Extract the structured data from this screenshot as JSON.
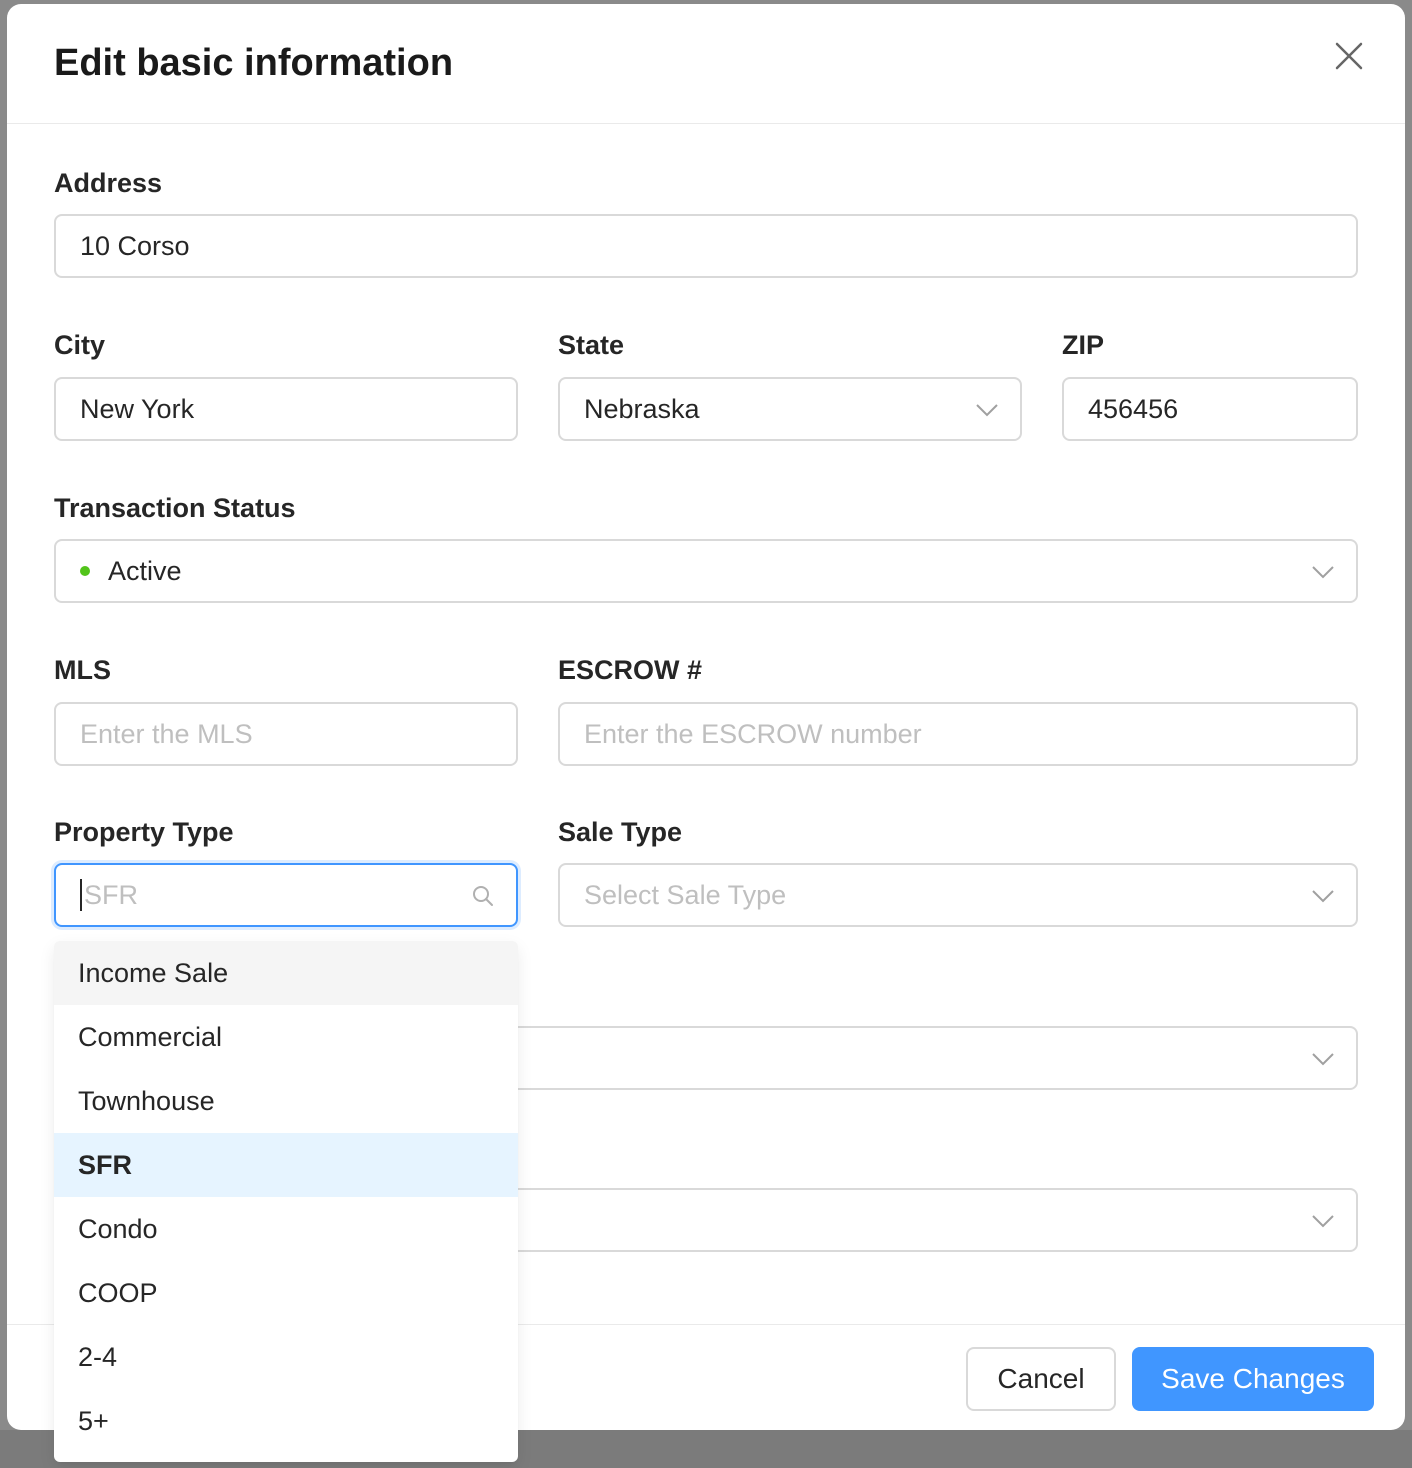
{
  "modal": {
    "title": "Edit basic information"
  },
  "address": {
    "label": "Address",
    "value": "10 Corso"
  },
  "city": {
    "label": "City",
    "value": "New York"
  },
  "state": {
    "label": "State",
    "value": "Nebraska"
  },
  "zip": {
    "label": "ZIP",
    "value": "456456"
  },
  "transaction_status": {
    "label": "Transaction Status",
    "value": "Active",
    "status_color": "#52c41a"
  },
  "mls": {
    "label": "MLS",
    "placeholder": "Enter the MLS"
  },
  "escrow": {
    "label": "ESCROW #",
    "placeholder": "Enter the ESCROW number"
  },
  "property_type": {
    "label": "Property Type",
    "search_placeholder": "SFR",
    "options": [
      "Income Sale",
      "Commercial",
      "Townhouse",
      "SFR",
      "Condo",
      "COOP",
      "2-4",
      "5+"
    ],
    "hovered": "Income Sale",
    "selected": "SFR"
  },
  "sale_type": {
    "label": "Sale Type",
    "placeholder": "Select Sale Type"
  },
  "footer": {
    "cancel_label": "Cancel",
    "save_label": "Save Changes"
  },
  "colors": {
    "primary": "#4096ff",
    "selected_bg": "#e6f4ff"
  }
}
